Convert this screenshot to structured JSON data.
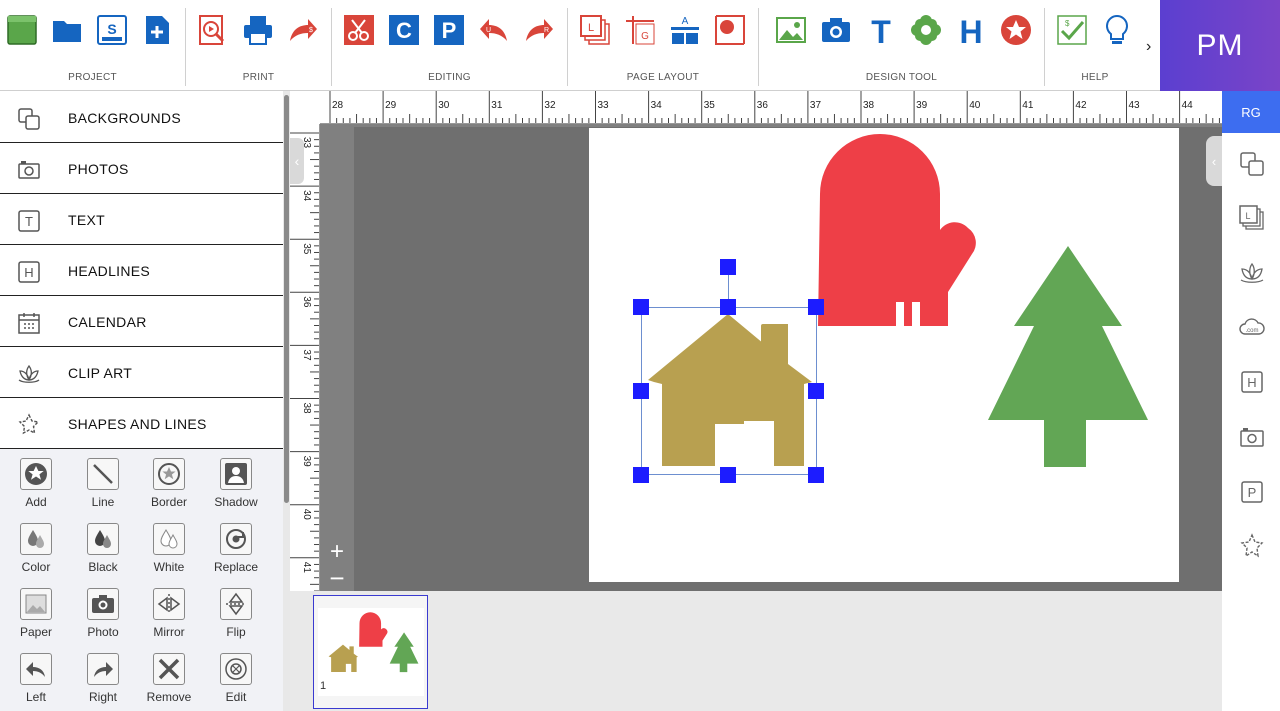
{
  "toolbar": {
    "groups": {
      "project": "PROJECT",
      "print": "PRINT",
      "editing": "EDITING",
      "page_layout": "PAGE LAYOUT",
      "design_tool": "DESIGN TOOL",
      "help": "HELP"
    },
    "more_glyph": "›",
    "user_initials": "PM",
    "accent_blue": "#1565c0",
    "accent_red": "#d9453a",
    "accent_green": "#5aa64a"
  },
  "left_panel": {
    "categories": [
      {
        "label": "BACKGROUNDS",
        "icon": "backgrounds-icon"
      },
      {
        "label": "PHOTOS",
        "icon": "camera-icon"
      },
      {
        "label": "TEXT",
        "icon": "text-icon"
      },
      {
        "label": "HEADLINES",
        "icon": "headline-icon"
      },
      {
        "label": "CALENDAR",
        "icon": "calendar-icon"
      },
      {
        "label": "CLIP ART",
        "icon": "lotus-icon"
      },
      {
        "label": "SHAPES AND LINES",
        "icon": "star-outline-icon"
      }
    ],
    "tools": [
      {
        "label": "Add",
        "icon": "star-badge-icon"
      },
      {
        "label": "Line",
        "icon": "line-icon"
      },
      {
        "label": "Border",
        "icon": "star-border-icon"
      },
      {
        "label": "Shadow",
        "icon": "shadow-icon"
      },
      {
        "label": "Color",
        "icon": "color-drops-icon"
      },
      {
        "label": "Black",
        "icon": "black-drops-icon"
      },
      {
        "label": "White",
        "icon": "white-drops-icon"
      },
      {
        "label": "Replace",
        "icon": "replace-icon"
      },
      {
        "label": "Paper",
        "icon": "paper-icon"
      },
      {
        "label": "Photo",
        "icon": "photo-icon"
      },
      {
        "label": "Mirror",
        "icon": "mirror-icon"
      },
      {
        "label": "Flip",
        "icon": "flip-icon"
      },
      {
        "label": "Left",
        "icon": "rotate-left-icon"
      },
      {
        "label": "Right",
        "icon": "rotate-right-icon"
      },
      {
        "label": "Remove",
        "icon": "remove-icon"
      },
      {
        "label": "Edit",
        "icon": "edit-icon"
      }
    ]
  },
  "workspace": {
    "ruler_top": [
      "28",
      "29",
      "30",
      "31",
      "32",
      "33",
      "34",
      "35",
      "36",
      "37",
      "38",
      "39",
      "40",
      "41",
      "42",
      "43",
      "44"
    ],
    "ruler_left": [
      "33",
      "34",
      "35",
      "36",
      "37",
      "38",
      "39",
      "40",
      "41"
    ],
    "zoom_in": "+",
    "zoom_out": "−",
    "collapse_glyph": "‹",
    "canvas_objects": [
      "mitten-shape",
      "house-shape",
      "tree-shape"
    ],
    "colors": {
      "mitten": "#ee3f47",
      "house": "#b8a050",
      "tree": "#62a655",
      "handle": "#1c1cff"
    }
  },
  "pages": [
    {
      "number": "1"
    }
  ],
  "right_rail": {
    "badge": "RG",
    "icons": [
      "backgrounds-icon",
      "layout-icon",
      "lotus-icon",
      "dotcom-cloud-icon",
      "headline-icon",
      "camera-icon",
      "parking-icon",
      "star-outline-icon"
    ],
    "badge_color": "#3d6df0"
  }
}
